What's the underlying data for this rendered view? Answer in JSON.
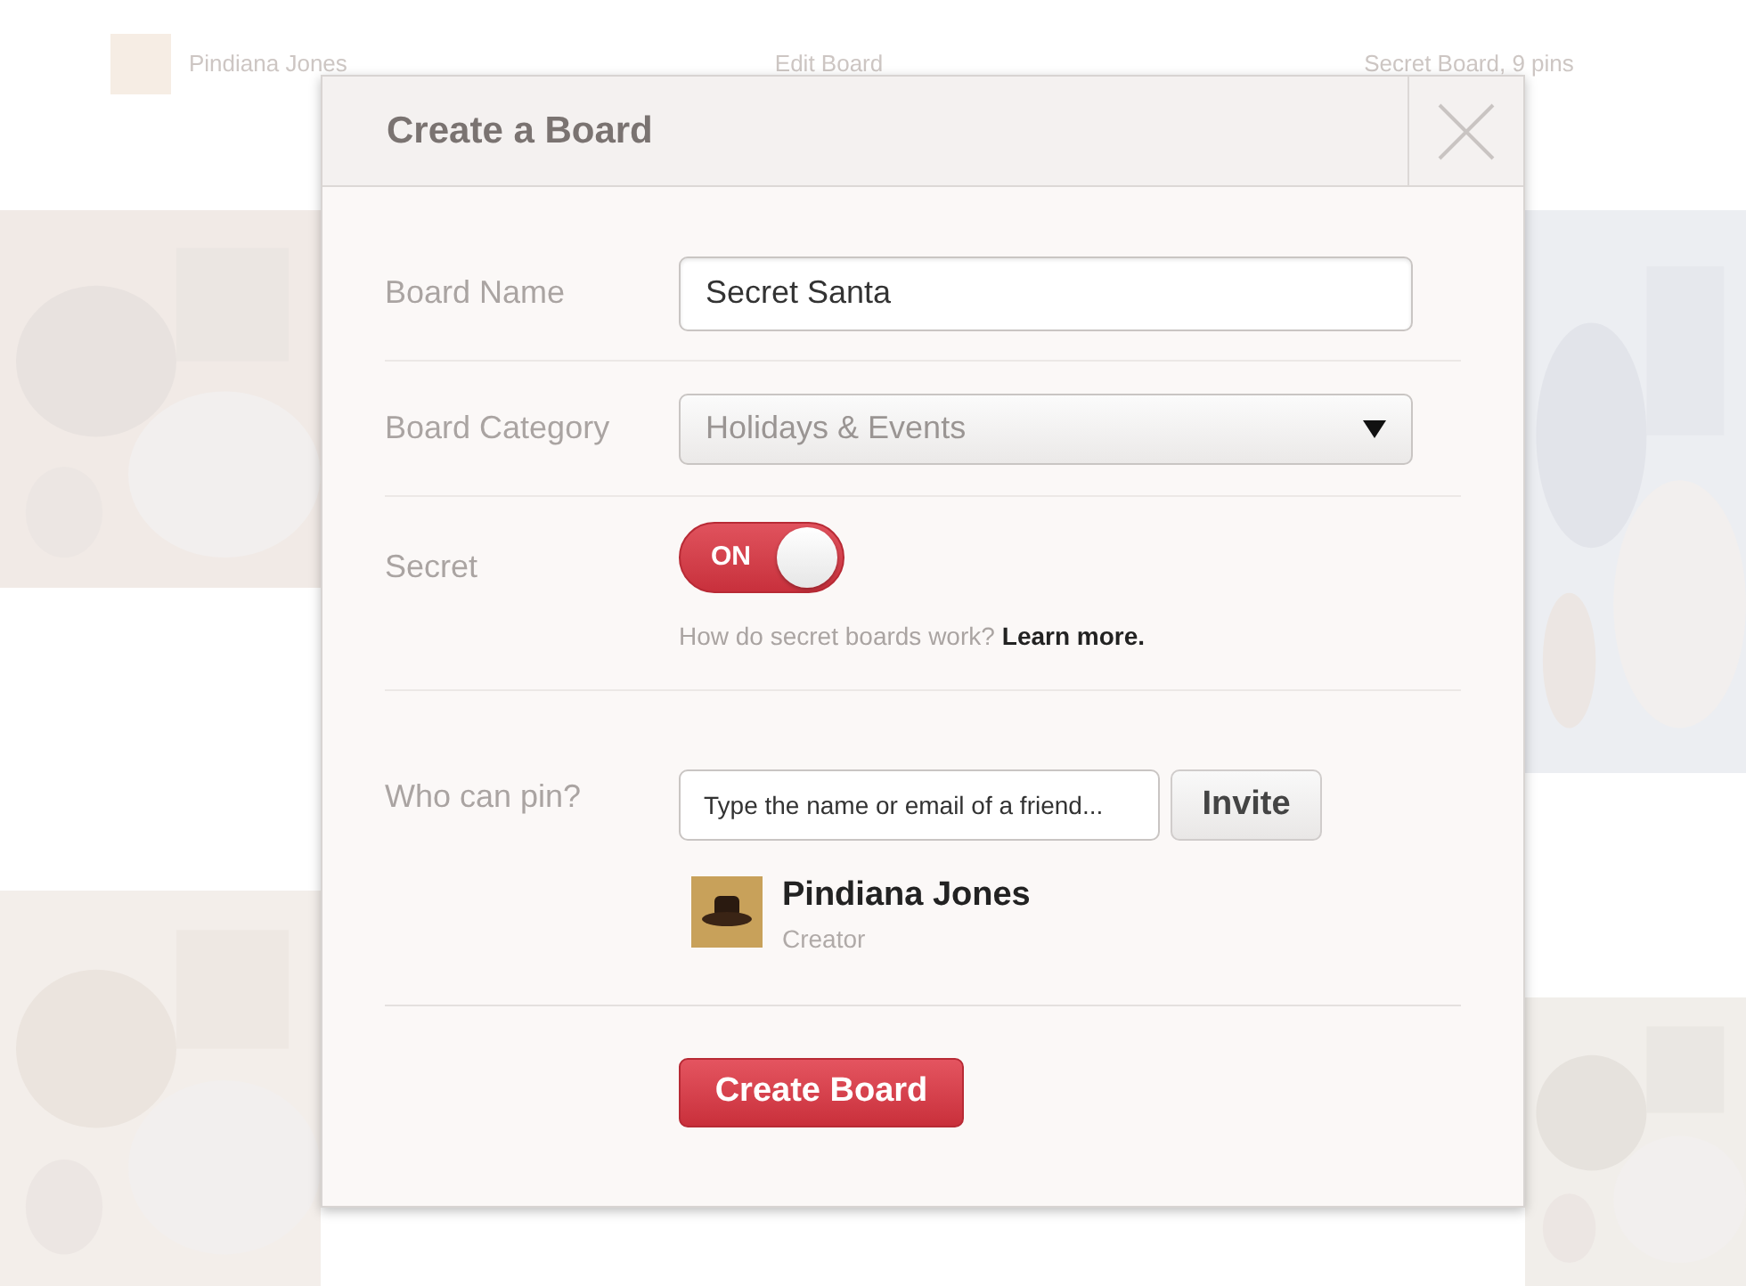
{
  "page_header": {
    "owner": "Pindiana Jones",
    "action": "Edit Board",
    "meta": "Secret Board, 9 pins"
  },
  "dialog": {
    "title": "Create a Board",
    "board_name": {
      "label": "Board Name",
      "value": "Secret Santa"
    },
    "board_category": {
      "label": "Board Category",
      "value": "Holidays & Events"
    },
    "secret": {
      "label": "Secret",
      "on": true,
      "toggle_text": "ON",
      "help": "How do secret boards work?",
      "link": "Learn more."
    },
    "collaborators": {
      "label": "Who can pin?",
      "placeholder": "Type the name or email of a friend...",
      "button": "Invite",
      "people": [
        {
          "name": "Pindiana Jones",
          "role": "Creator"
        }
      ]
    },
    "submit": "Create Board"
  }
}
